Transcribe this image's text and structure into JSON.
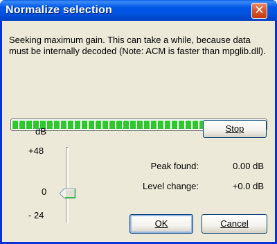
{
  "window": {
    "title": "Normalize selection"
  },
  "message": "Seeking maximum gain. This can take a while, because data must be internally decoded (Note: ACM is faster than mpglib.dll).",
  "progress": {
    "fraction": 1.0,
    "color": "#2cc82c"
  },
  "buttons": {
    "stop": "Stop",
    "ok": "OK",
    "cancel": "Cancel"
  },
  "slider": {
    "unit": "dB",
    "max_label": "+48",
    "zero_label": "0",
    "min_label": "- 24",
    "value": 0
  },
  "stats": {
    "peak_label": "Peak found:",
    "peak_value": "0.00 dB",
    "level_label": "Level change:",
    "level_value": "+0.0 dB"
  },
  "colors": {
    "title_bar": "#0054e3",
    "close_button": "#d95a30",
    "dialog_bg": "#ece9d8"
  }
}
